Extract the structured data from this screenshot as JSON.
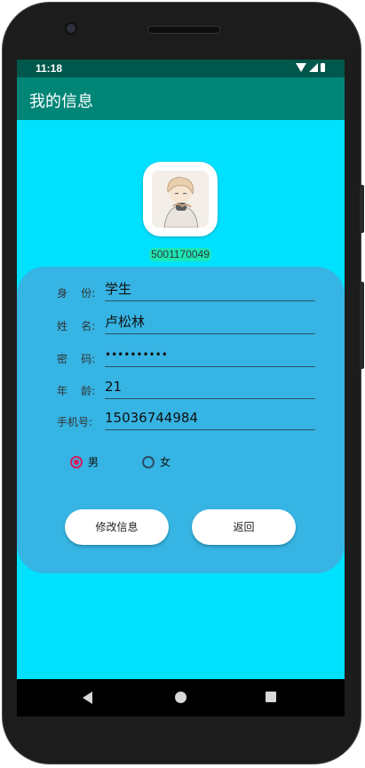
{
  "status_bar": {
    "time": "11:18"
  },
  "app_bar": {
    "title": "我的信息"
  },
  "profile": {
    "user_id": "5001170049"
  },
  "fields": [
    {
      "label": "身    份:",
      "value": "学生"
    },
    {
      "label": "姓    名:",
      "value": "卢松林"
    },
    {
      "label": "密    码:",
      "value": "••••••••••"
    },
    {
      "label": "年    龄:",
      "value": "21"
    },
    {
      "label": "手机号:",
      "value": "15036744984"
    }
  ],
  "gender": {
    "options": [
      {
        "label": "男",
        "checked": true
      },
      {
        "label": "女",
        "checked": false
      }
    ]
  },
  "buttons": {
    "edit": "修改信息",
    "back": "返回"
  },
  "colors": {
    "screen_bg": "#00e0ff",
    "card_bg": "#36b4e3",
    "app_bar": "#008577",
    "status_bar": "#00574b",
    "radio_checked": "#d81b60"
  },
  "icons": {
    "status": [
      "wifi-icon",
      "signal-icon",
      "battery-icon"
    ],
    "nav": [
      "back-icon",
      "home-icon",
      "recent-apps-icon"
    ]
  }
}
